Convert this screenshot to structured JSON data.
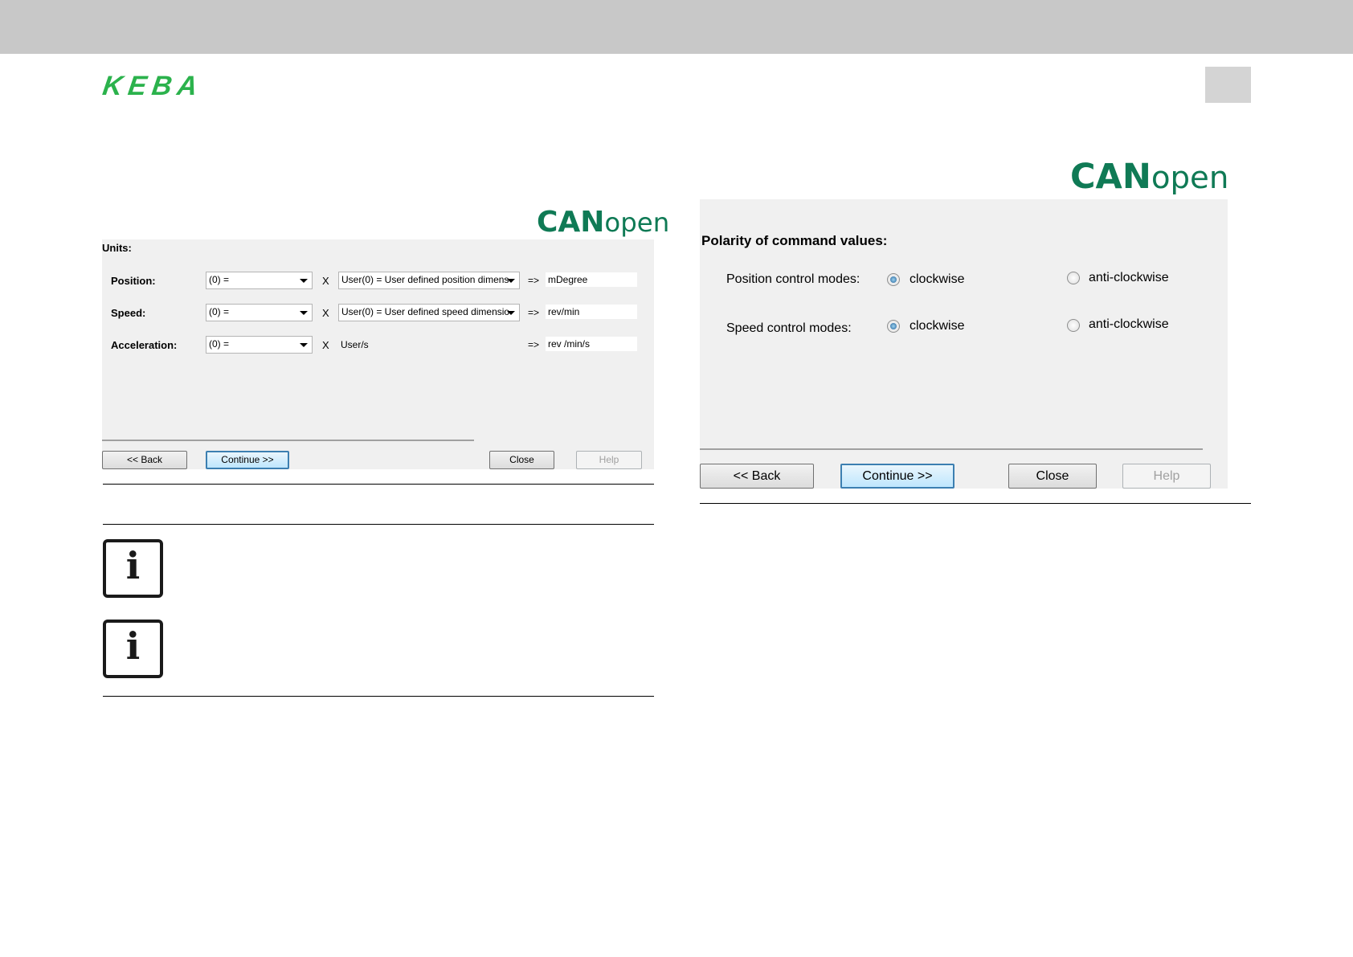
{
  "header": {
    "logo_text": "KEBA"
  },
  "left_dialog": {
    "canopen_bold": "CAN",
    "canopen_light": "open",
    "section_title": "Units:",
    "rows": [
      {
        "label": "Position:",
        "combo": "(0) =",
        "times": "X",
        "unit_combo": "User(0) = User defined position dimens",
        "arrow": "=>",
        "result": "mDegree"
      },
      {
        "label": "Speed:",
        "combo": "(0) =",
        "times": "X",
        "unit_combo": "User(0) = User defined speed dimensio",
        "arrow": "=>",
        "result": "rev/min"
      },
      {
        "label": "Acceleration:",
        "combo": "(0) =",
        "times": "X",
        "unit_text": "User/s",
        "arrow": "=>",
        "result": "rev /min/s"
      }
    ],
    "buttons": {
      "back": "<< Back",
      "continue": "Continue >>",
      "close": "Close",
      "help": "Help"
    }
  },
  "right_dialog": {
    "canopen_bold": "CAN",
    "canopen_light": "open",
    "section_title": "Polarity of command values:",
    "rows": [
      {
        "label": "Position control modes:",
        "option1": "clockwise",
        "option2": "anti-clockwise",
        "selected": "clockwise"
      },
      {
        "label": "Speed control modes:",
        "option1": "clockwise",
        "option2": "anti-clockwise",
        "selected": "clockwise"
      }
    ],
    "buttons": {
      "back": "<< Back",
      "continue": "Continue >>",
      "close": "Close",
      "help": "Help"
    }
  },
  "icons": [
    "info-icon",
    "info-icon"
  ]
}
